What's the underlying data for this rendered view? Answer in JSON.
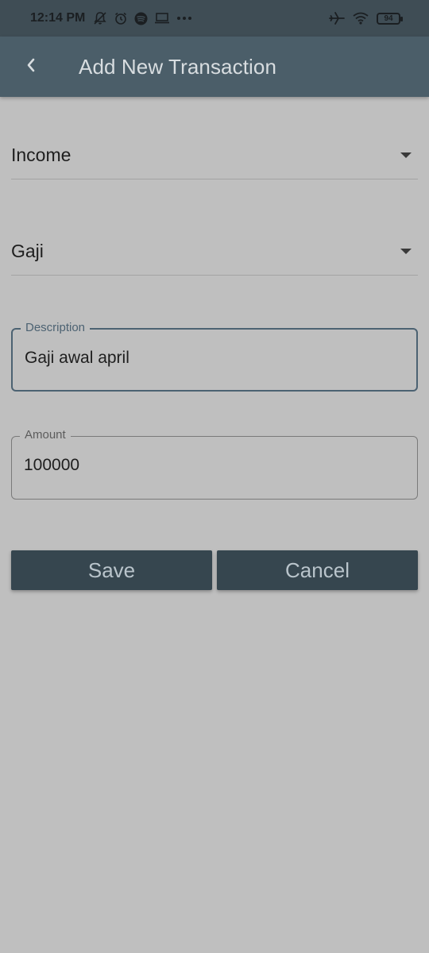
{
  "status_bar": {
    "time": "12:14 PM",
    "icons_left": [
      "notifications-off-icon",
      "alarm-icon",
      "spotify-icon",
      "laptop-icon",
      "more-dots-icon"
    ],
    "icons_right": [
      "airplane-mode-icon",
      "wifi-icon",
      "battery-icon"
    ],
    "battery_level": "94"
  },
  "app_bar": {
    "back_icon": "chevron-left-icon",
    "title": "Add New Transaction"
  },
  "form": {
    "type_dropdown": {
      "value": "Income",
      "icon": "dropdown-arrow-icon"
    },
    "category_dropdown": {
      "value": "Gaji",
      "icon": "dropdown-arrow-icon"
    },
    "description": {
      "label": "Description",
      "value": "Gaji awal april"
    },
    "amount": {
      "label": "Amount",
      "value": "100000"
    }
  },
  "actions": {
    "save_label": "Save",
    "cancel_label": "Cancel"
  },
  "colors": {
    "background": "#bfbfbf",
    "status_bar": "#3f4d55",
    "app_bar": "#4b5e69",
    "accent": "#4c6272",
    "button": "#36464f",
    "button_text": "#b9c4cb"
  }
}
